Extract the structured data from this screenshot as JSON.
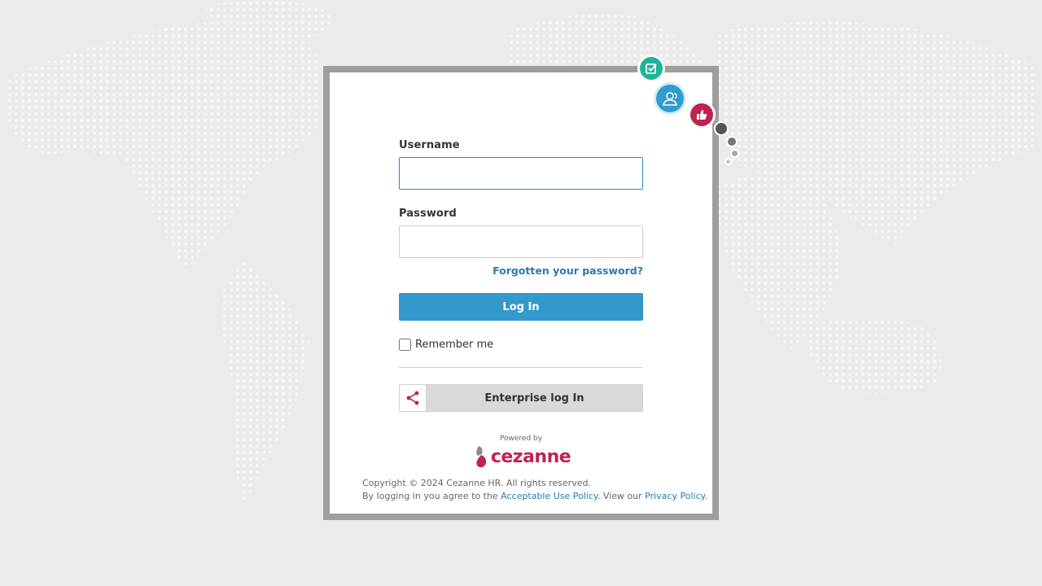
{
  "form": {
    "username_label": "Username",
    "username_value": "",
    "password_label": "Password",
    "password_value": "",
    "forgot_link": "Forgotten your password?",
    "login_button": "Log In",
    "remember_label": "Remember me",
    "remember_checked": false,
    "enterprise_button": "Enterprise log In"
  },
  "branding": {
    "powered_by": "Powered by",
    "logo_text": "cezanne",
    "brand_color": "#c1234f",
    "accent_color": "#3399cc"
  },
  "footer": {
    "copyright": "Copyright © 2024 Cezanne HR. All rights reserved.",
    "agree_prefix": "By logging in you agree to the ",
    "aup_link": "Acceptable Use Policy",
    "view_text": ". View our ",
    "privacy_link": "Privacy Policy",
    "end": "."
  },
  "decor": {
    "icons": [
      "checkbox-icon",
      "people-icon",
      "thumbs-up-icon",
      "share-icon"
    ],
    "colors": {
      "teal": "#1db596",
      "blue": "#2e9bd1",
      "crimson": "#c1234f"
    }
  }
}
